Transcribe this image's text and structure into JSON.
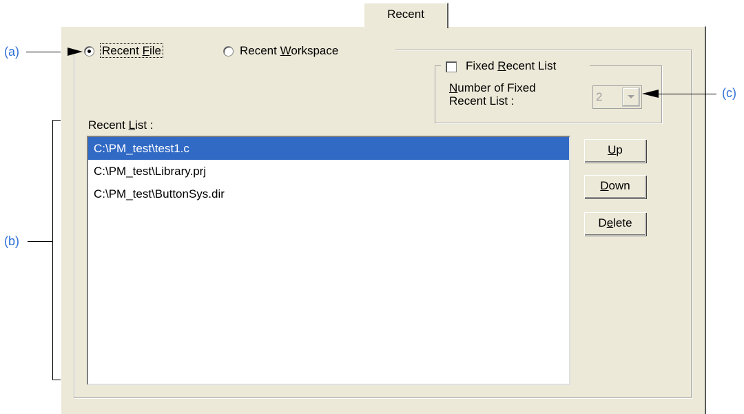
{
  "annotations": {
    "a": "(a)",
    "b": "(b)",
    "c": "(c)"
  },
  "tab": {
    "label": "Recent"
  },
  "mode": {
    "recent_file": {
      "label_pre": "Recent ",
      "label_key": "F",
      "label_post": "ile",
      "selected": true
    },
    "recent_workspace": {
      "label_pre": "Recent ",
      "label_key": "W",
      "label_post": "orkspace",
      "selected": false
    }
  },
  "fixed": {
    "checkbox": {
      "label_pre": "Fixed ",
      "label_key": "R",
      "label_post": "ecent List",
      "checked": false
    },
    "count_label_key": "N",
    "count_label_line1": "umber of Fixed",
    "count_label_line2": "Recent List :",
    "count_value": "2"
  },
  "recent_list": {
    "label_pre": "Recent ",
    "label_key": "L",
    "label_post": "ist :",
    "items": [
      {
        "path": "C:\\PM_test\\test1.c",
        "selected": true
      },
      {
        "path": "C:\\PM_test\\Library.prj",
        "selected": false
      },
      {
        "path": "C:\\PM_test\\ButtonSys.dir",
        "selected": false
      }
    ]
  },
  "buttons": {
    "up": {
      "key": "U",
      "rest": "p"
    },
    "down": {
      "key": "D",
      "rest": "own"
    },
    "delete": {
      "pre": "D",
      "key": "e",
      "rest": "lete"
    }
  },
  "colors": {
    "annotation": "#2e6fd6",
    "selection": "#316ac5",
    "dialog_bg": "#ece9d8"
  }
}
